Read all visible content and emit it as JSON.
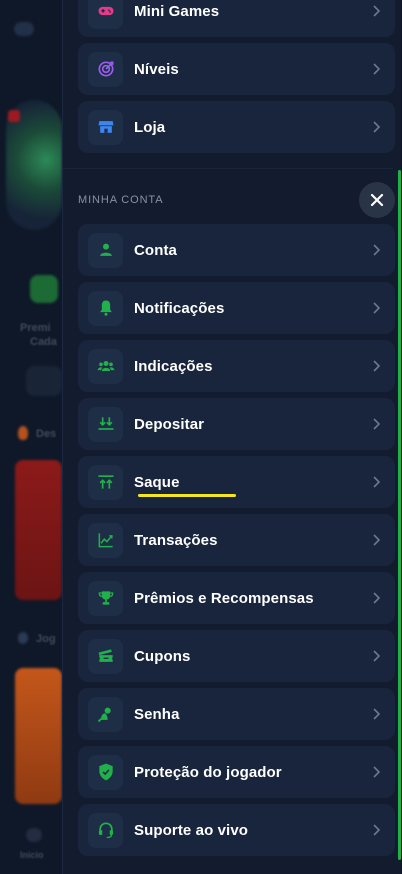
{
  "background_app": {
    "texts": [
      "Premi",
      "Cada",
      "Des",
      "Jog",
      "Inicio"
    ]
  },
  "menu_top": [
    {
      "label": "Mini Games",
      "icon": "gamepad-icon"
    },
    {
      "label": "Níveis",
      "icon": "target-icon"
    },
    {
      "label": "Loja",
      "icon": "store-icon"
    }
  ],
  "account": {
    "title": "MINHA CONTA",
    "items": [
      {
        "label": "Conta",
        "icon": "user-icon"
      },
      {
        "label": "Notificações",
        "icon": "bell-icon"
      },
      {
        "label": "Indicações",
        "icon": "users-icon"
      },
      {
        "label": "Depositar",
        "icon": "deposit-icon"
      },
      {
        "label": "Saque",
        "icon": "withdraw-icon"
      },
      {
        "label": "Transações",
        "icon": "chart-line-icon"
      },
      {
        "label": "Prêmios e Recompensas",
        "icon": "trophy-icon"
      },
      {
        "label": "Cupons",
        "icon": "ticket-icon"
      },
      {
        "label": "Senha",
        "icon": "key-icon"
      },
      {
        "label": "Proteção do jogador",
        "icon": "shield-icon"
      },
      {
        "label": "Suporte ao vivo",
        "icon": "headset-icon"
      }
    ]
  },
  "colors": {
    "accent_green": "#21b14a",
    "highlight_yellow": "#f4e622",
    "card_bg": "#19253c",
    "drawer_bg": "#121c2e"
  }
}
